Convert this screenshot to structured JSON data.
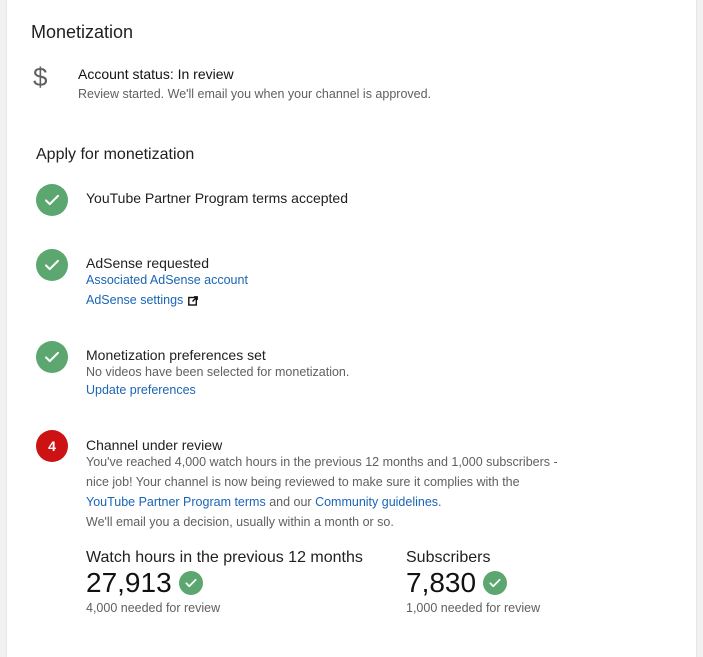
{
  "monetization": {
    "title": "Monetization",
    "icon": "dollar-icon",
    "account_status": "Account status: In review",
    "account_status_sub": "Review started. We'll email you when your channel is approved."
  },
  "apply": {
    "title": "Apply for monetization",
    "steps": [
      {
        "status": "done",
        "title": "YouTube Partner Program terms accepted"
      },
      {
        "status": "done",
        "title": "AdSense requested",
        "links": [
          "Associated AdSense account",
          "AdSense settings"
        ]
      },
      {
        "status": "done",
        "title": "Monetization preferences set",
        "sub": "No videos have been selected for monetization.",
        "link": "Update preferences"
      },
      {
        "status": "pending",
        "number": "4",
        "title": "Channel under review",
        "text_1": "You've reached 4,000 watch hours in the previous 12 months and 1,000 subscribers - nice job! Your channel is now being reviewed to make sure it complies with the ",
        "link_terms": "YouTube Partner Program terms",
        "text_2": " and our ",
        "link_guidelines": "Community guidelines",
        "text_3": ".",
        "text_4": "We'll email you a decision, usually within a month or so."
      }
    ]
  },
  "stats": [
    {
      "label": "Watch hours in the previous 12 months",
      "value": "27,913",
      "note": "4,000 needed for review"
    },
    {
      "label": "Subscribers",
      "value": "7,830",
      "note": "1,000 needed for review"
    }
  ],
  "colors": {
    "check": "#5ca76f",
    "pending": "#cc1212",
    "link": "#1a65b5"
  }
}
